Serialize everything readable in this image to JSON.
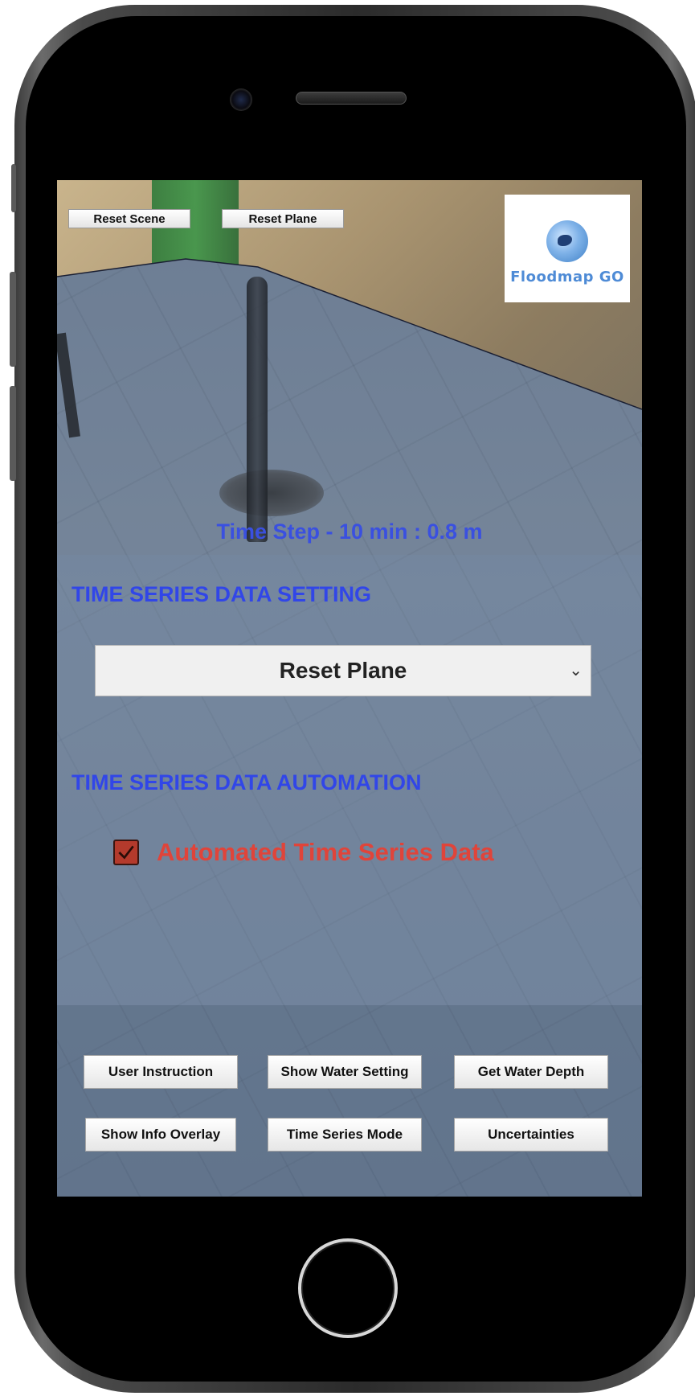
{
  "top_bar": {
    "reset_scene_label": "Reset Scene",
    "reset_plane_label": "Reset Plane"
  },
  "logo": {
    "icon": "globe-icon",
    "text": "Floodmap GO"
  },
  "status": {
    "time_step": "Time Step - 10 min : 0.8 m"
  },
  "time_series_setting": {
    "title": "TIME SERIES DATA SETTING",
    "dropdown_selected": "Reset Plane",
    "dropdown_icon": "chevron-down-icon"
  },
  "time_series_automation": {
    "title": "TIME SERIES DATA AUTOMATION",
    "checkbox_checked": true,
    "checkbox_label": "Automated Time Series Data"
  },
  "actions": {
    "row1": [
      "User Instruction",
      "Show Water Setting",
      "Get Water Depth"
    ],
    "row2": [
      "Show Info Overlay",
      "Time Series Mode",
      "Uncertainties"
    ]
  },
  "colors": {
    "section_title": "#3146e8",
    "checkbox_label": "#e0443a",
    "checkbox_fill": "#b43a2c"
  }
}
